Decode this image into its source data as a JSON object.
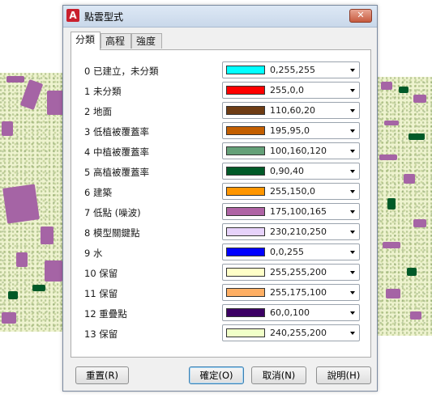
{
  "window": {
    "title": "點雲型式",
    "close_glyph": "✕",
    "logo": "A"
  },
  "tabs": [
    {
      "label": "分類",
      "active": true
    },
    {
      "label": "高程",
      "active": false
    },
    {
      "label": "強度",
      "active": false
    }
  ],
  "rows": [
    {
      "label": "0 已建立，未分類",
      "color_hex": "#00ffff",
      "rgb": "0,255,255"
    },
    {
      "label": "1 未分類",
      "color_hex": "#ff0000",
      "rgb": "255,0,0"
    },
    {
      "label": "2 地面",
      "color_hex": "#6e3c14",
      "rgb": "110,60,20"
    },
    {
      "label": "3 低植被覆蓋率",
      "color_hex": "#c35f00",
      "rgb": "195,95,0"
    },
    {
      "label": "4 中植被覆蓋率",
      "color_hex": "#64a078",
      "rgb": "100,160,120"
    },
    {
      "label": "5 高植被覆蓋率",
      "color_hex": "#005a28",
      "rgb": "0,90,40"
    },
    {
      "label": "6 建築",
      "color_hex": "#ff9600",
      "rgb": "255,150,0"
    },
    {
      "label": "7 低點 (噪波)",
      "color_hex": "#af64a5",
      "rgb": "175,100,165"
    },
    {
      "label": "8 模型關鍵點",
      "color_hex": "#e6d2fa",
      "rgb": "230,210,250"
    },
    {
      "label": "9 水",
      "color_hex": "#0000ff",
      "rgb": "0,0,255"
    },
    {
      "label": "10 保留",
      "color_hex": "#ffffc8",
      "rgb": "255,255,200"
    },
    {
      "label": "11 保留",
      "color_hex": "#ffaf64",
      "rgb": "255,175,100"
    },
    {
      "label": "12 重疊點",
      "color_hex": "#3c0064",
      "rgb": "60,0,100"
    },
    {
      "label": "13 保留",
      "color_hex": "#f0ffc8",
      "rgb": "240,255,200"
    }
  ],
  "buttons": {
    "reset": "重置(R)",
    "ok": "確定(O)",
    "cancel": "取消(N)",
    "help": "說明(H)"
  }
}
